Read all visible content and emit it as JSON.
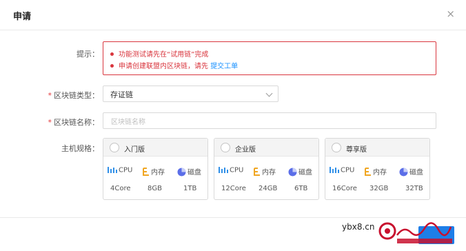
{
  "dialog": {
    "title": "申请",
    "close_label": "×"
  },
  "tip": {
    "label": "提示：",
    "line1": "功能测试请先在“试用链”完成",
    "line2_prefix": "申请创建联盟内区块链，请先",
    "line2_link": "提交工单"
  },
  "chain_type": {
    "label": "区块链类型：",
    "value": "存证链"
  },
  "chain_name": {
    "label": "区块链名称：",
    "placeholder": "区块链名称"
  },
  "host_spec": {
    "label": "主机规格：",
    "spec_labels": {
      "cpu": "CPU",
      "memory": "内存",
      "disk": "磁盘"
    },
    "cards": [
      {
        "name": "入门版",
        "cpu": "4Core",
        "memory": "8GB",
        "disk": "1TB"
      },
      {
        "name": "企业版",
        "cpu": "12Core",
        "memory": "24GB",
        "disk": "6TB"
      },
      {
        "name": "尊享版",
        "cpu": "16Core",
        "memory": "32GB",
        "disk": "32TB"
      }
    ]
  },
  "watermark": {
    "text": "ybx8.cn"
  },
  "colors": {
    "alert": "#d9363e",
    "link": "#1890ff",
    "cpu_icon": "#2f8fe8",
    "memory_icon": "#f0a623",
    "disk_icon": "#5b6ee8"
  }
}
